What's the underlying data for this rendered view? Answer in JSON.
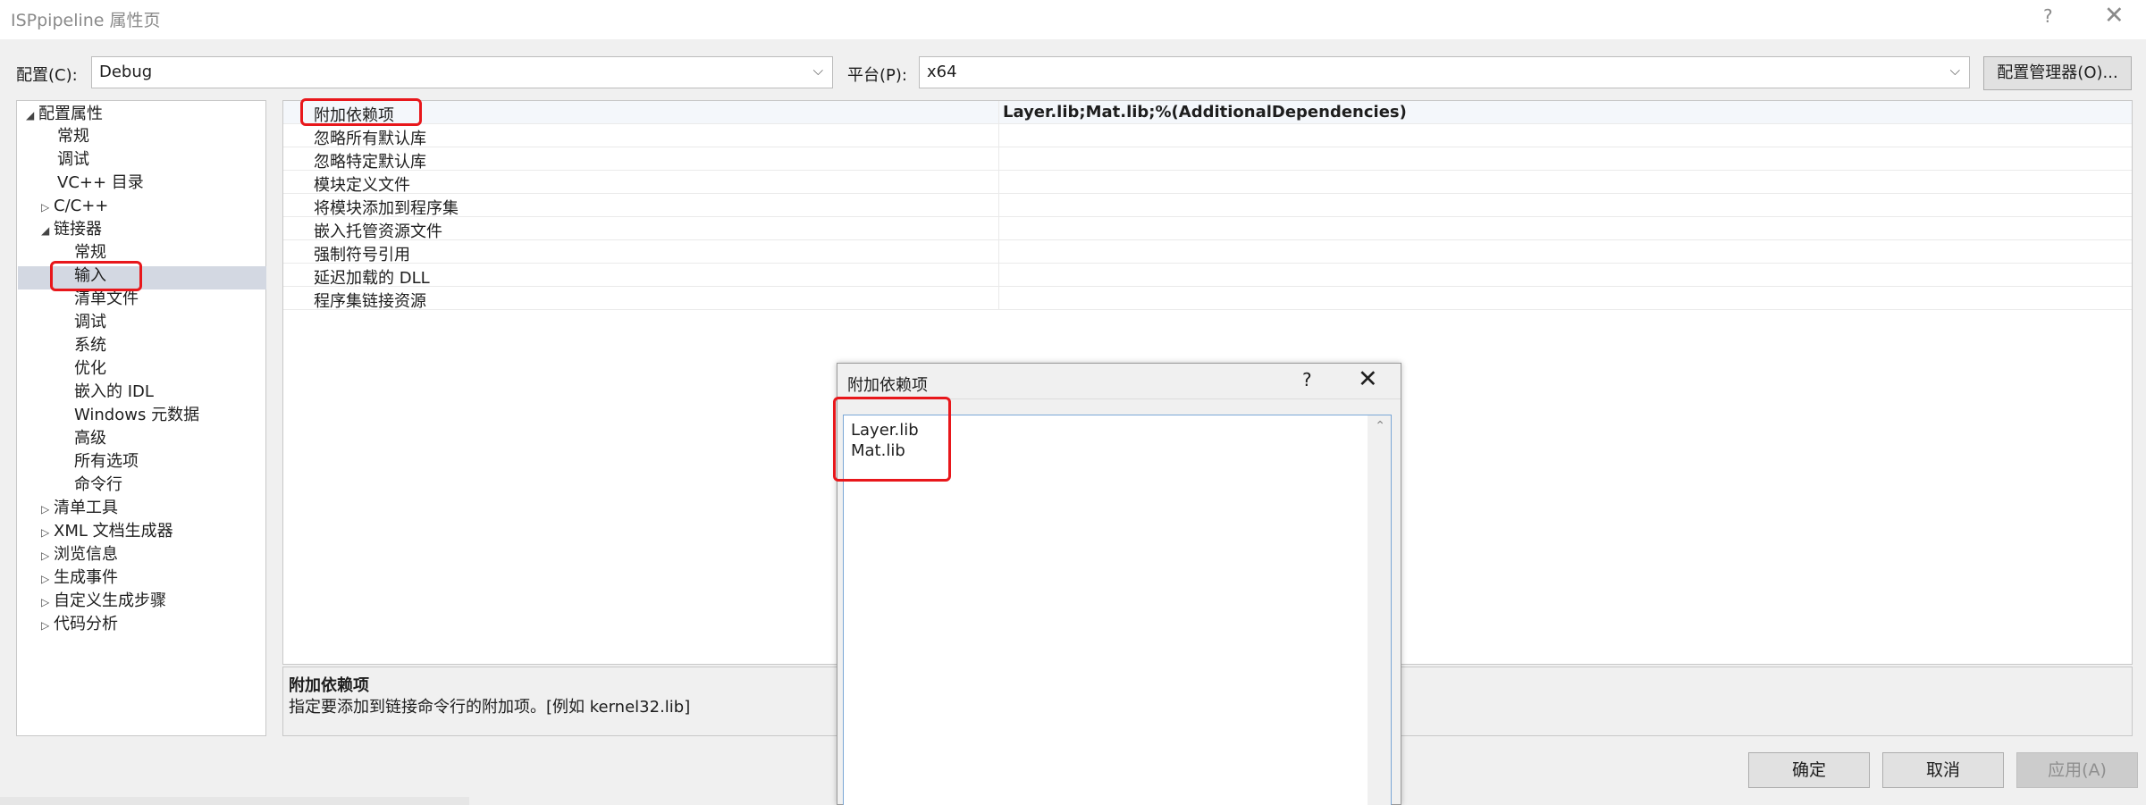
{
  "window": {
    "title": "ISPpipeline 属性页",
    "help_glyph": "?",
    "close_glyph": "✕"
  },
  "config": {
    "label": "配置(C):",
    "value": "Debug",
    "platform_label": "平台(P):",
    "platform_value": "x64",
    "manager_button": "配置管理器(O)..."
  },
  "tree": {
    "items": [
      {
        "label": "配置属性",
        "expander": "◢"
      },
      {
        "label": "常规",
        "expander": ""
      },
      {
        "label": "调试",
        "expander": ""
      },
      {
        "label": "VC++ 目录",
        "expander": ""
      },
      {
        "label": "C/C++",
        "expander": "▷"
      },
      {
        "label": "链接器",
        "expander": "◢"
      },
      {
        "label": "常规",
        "expander": ""
      },
      {
        "label": "输入",
        "expander": ""
      },
      {
        "label": "清单文件",
        "expander": ""
      },
      {
        "label": "调试",
        "expander": ""
      },
      {
        "label": "系统",
        "expander": ""
      },
      {
        "label": "优化",
        "expander": ""
      },
      {
        "label": "嵌入的 IDL",
        "expander": ""
      },
      {
        "label": "Windows 元数据",
        "expander": ""
      },
      {
        "label": "高级",
        "expander": ""
      },
      {
        "label": "所有选项",
        "expander": ""
      },
      {
        "label": "命令行",
        "expander": ""
      },
      {
        "label": "清单工具",
        "expander": "▷"
      },
      {
        "label": "XML 文档生成器",
        "expander": "▷"
      },
      {
        "label": "浏览信息",
        "expander": "▷"
      },
      {
        "label": "生成事件",
        "expander": "▷"
      },
      {
        "label": "自定义生成步骤",
        "expander": "▷"
      },
      {
        "label": "代码分析",
        "expander": "▷"
      }
    ]
  },
  "grid": {
    "rows": [
      {
        "name": "附加依赖项",
        "value": "Layer.lib;Mat.lib;%(AdditionalDependencies)"
      },
      {
        "name": "忽略所有默认库",
        "value": ""
      },
      {
        "name": "忽略特定默认库",
        "value": ""
      },
      {
        "name": "模块定义文件",
        "value": ""
      },
      {
        "name": "将模块添加到程序集",
        "value": ""
      },
      {
        "name": "嵌入托管资源文件",
        "value": ""
      },
      {
        "name": "强制符号引用",
        "value": ""
      },
      {
        "name": "延迟加载的 DLL",
        "value": ""
      },
      {
        "name": "程序集链接资源",
        "value": ""
      }
    ]
  },
  "description": {
    "title": "附加依赖项",
    "text": "指定要添加到链接命令行的附加项。[例如 kernel32.lib]"
  },
  "buttons": {
    "ok": "确定",
    "cancel": "取消",
    "apply": "应用(A)"
  },
  "dialog": {
    "title": "附加依赖项",
    "help_glyph": "?",
    "close_glyph": "✕",
    "lines": [
      "Layer.lib",
      "Mat.lib"
    ]
  }
}
